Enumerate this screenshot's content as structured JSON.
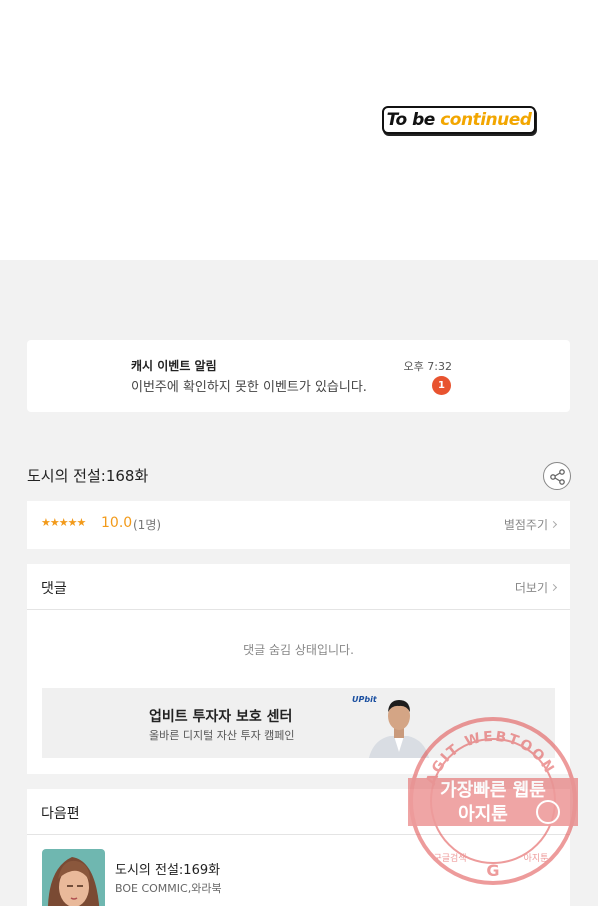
{
  "banner": {
    "part1": "To be ",
    "part2": "continued"
  },
  "notification": {
    "title": "캐시 이벤트 알림",
    "message": "이번주에 확인하지 못한 이벤트가 있습니다.",
    "time": "오후 7:32",
    "badge": "1"
  },
  "episode": {
    "title": "도시의 전설:168화"
  },
  "rating": {
    "stars": "★★★★★",
    "score": "10.0",
    "count": "(1명)",
    "rate_label": "별점주기"
  },
  "comments": {
    "title": "댓글",
    "more_label": "더보기",
    "hidden_message": "댓글 숨김 상태입니다."
  },
  "ad": {
    "title": "업비트 투자자 보호 센터",
    "subtitle": "올바른 디지털 자산 투자 캠페인",
    "logo": "UPbit"
  },
  "next": {
    "title": "다음편",
    "episode_title": "도시의 전설:169화",
    "author": "BOE COMMIC,와라북"
  },
  "watermark": {
    "ring_text": "AGIT WEBTOON",
    "line1": "가장빠른 웹툰",
    "line2": "아지툰",
    "bottom_left": "구글검색",
    "bottom_right": "아지툰"
  },
  "colors": {
    "accent_orange": "#f29a1a",
    "badge_red": "#e8532f",
    "stamp_red": "#e04a4a"
  }
}
